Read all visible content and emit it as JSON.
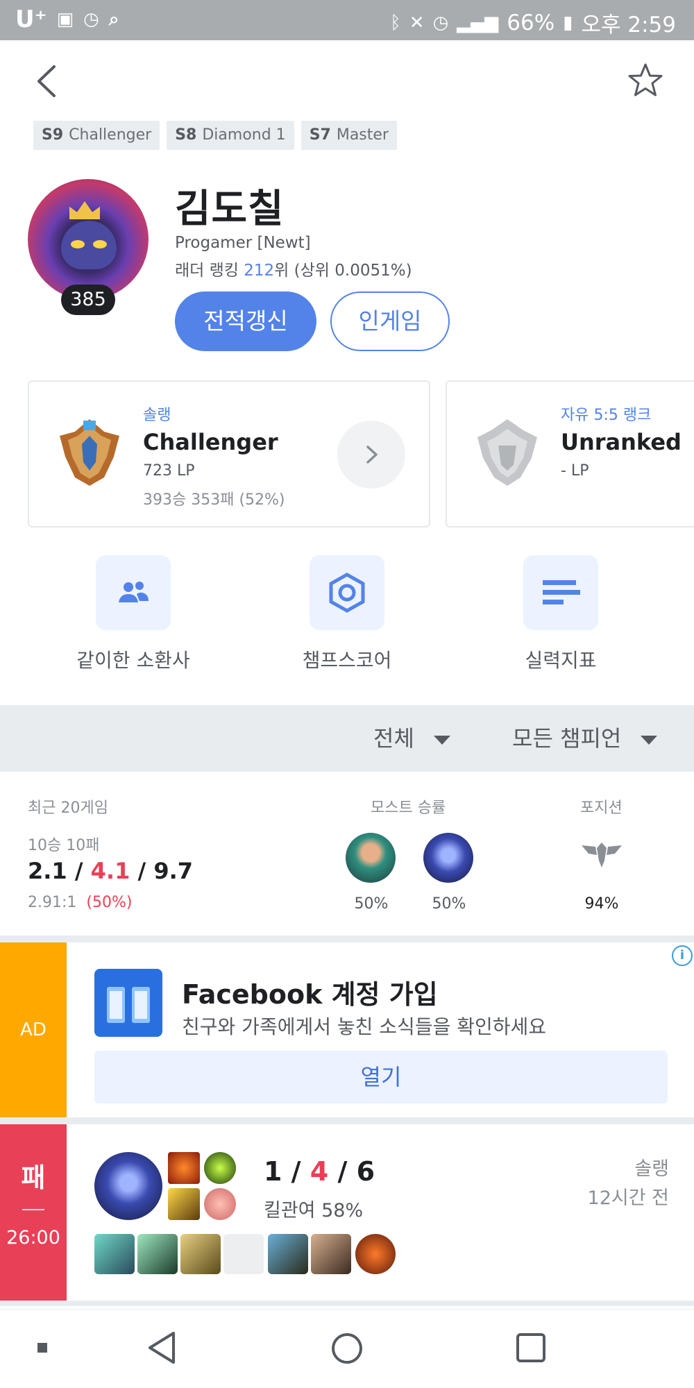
{
  "status_bar": {
    "carrier": "U⁺",
    "battery": "66%",
    "time": "오후 2:59"
  },
  "header": {
    "back_icon": "chevron-left-icon",
    "favorite_icon": "star-outline-icon"
  },
  "seasons": [
    {
      "season": "S9",
      "tier": "Challenger"
    },
    {
      "season": "S8",
      "tier": "Diamond 1"
    },
    {
      "season": "S7",
      "tier": "Master"
    }
  ],
  "profile": {
    "name": "김도칠",
    "level": "385",
    "subtitle": "Progamer [Newt]",
    "ladder_prefix": "래더 랭킹 ",
    "ladder_rank": "212",
    "ladder_suffix": "위 (상위 0.0051%)",
    "refresh_label": "전적갱신",
    "ingame_label": "인게임"
  },
  "ranks": [
    {
      "queue": "솔랭",
      "tier": "Challenger",
      "lp": "723 LP",
      "record": "393승 353패 (52%)"
    },
    {
      "queue": "자유 5:5 랭크",
      "tier": "Unranked",
      "lp": "- LP"
    }
  ],
  "quick_menu": [
    {
      "label": "같이한 소환사",
      "icon": "people-icon"
    },
    {
      "label": "챔프스코어",
      "icon": "hexagon-target-icon"
    },
    {
      "label": "실력지표",
      "icon": "bars-icon"
    }
  ],
  "filters": {
    "queue": "전체",
    "champion": "모든 챔피언"
  },
  "summary": {
    "recent_label": "최근 20게임",
    "wl": "10승 10패",
    "kills": "2.1",
    "deaths": "4.1",
    "assists": "9.7",
    "kda_ratio": "2.91:1",
    "winrate": "(50%)",
    "most_label": "모스트 승률",
    "most": [
      {
        "winrate": "50%"
      },
      {
        "winrate": "50%"
      }
    ],
    "position_label": "포지션",
    "position_icon": "support-role-icon",
    "position_pct": "94%"
  },
  "ad": {
    "badge": "AD",
    "title": "Facebook 계정 가입",
    "description": "친구와 가족에게서 놓친 소식들을 확인하세요",
    "button": "열기"
  },
  "match": {
    "result": "패",
    "duration": "26:00",
    "kills": "1",
    "deaths": "4",
    "assists": "6",
    "kill_participation": "킬관여 58%",
    "queue": "솔랭",
    "time_ago": "12시간 전"
  },
  "colors": {
    "accent": "#5383e8",
    "loss": "#e84057",
    "ad": "#ffa800",
    "status_bar": "#a9acae"
  }
}
